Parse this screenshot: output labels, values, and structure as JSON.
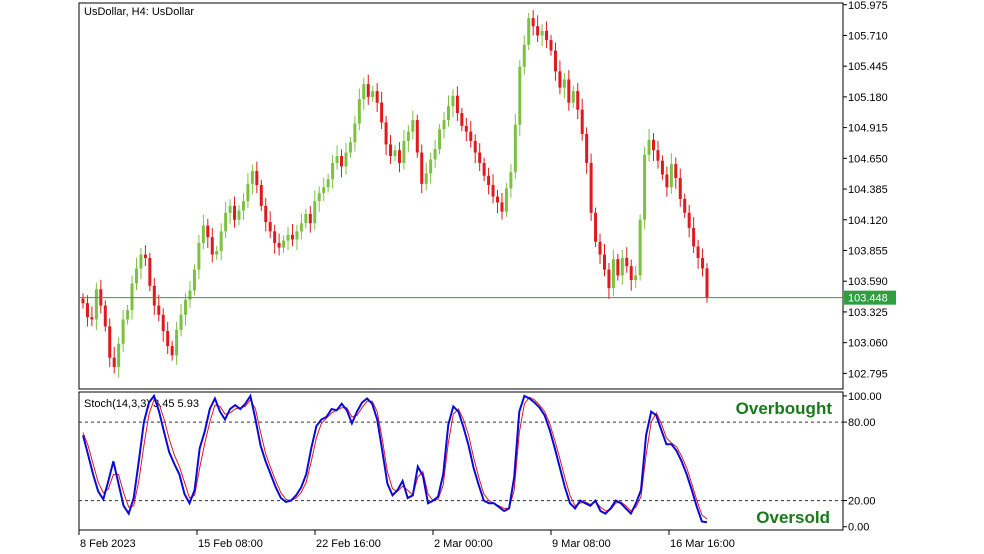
{
  "window": {
    "title": "UsDollar, H4:  UsDollar"
  },
  "colors": {
    "bull": "#7cc242",
    "bear": "#e0191c",
    "grid_border": "#000000",
    "price_line": "#2e9e3e",
    "k_line": "#0a0ad8",
    "d_line": "#e0191c",
    "annotation": "#1a7a1a"
  },
  "chart_data": [
    {
      "type": "candlestick",
      "title": "UsDollar, H4:  UsDollar",
      "y_ticks": [
        "105.975",
        "105.710",
        "105.445",
        "105.180",
        "104.915",
        "104.650",
        "104.385",
        "104.120",
        "103.855",
        "103.590",
        "103.325",
        "103.060",
        "102.795"
      ],
      "ylim": [
        102.66,
        105.99
      ],
      "x_ticks": [
        "8 Feb 2023",
        "15 Feb 08:00",
        "22 Feb 16:00",
        "2 Mar 00:00",
        "9 Mar 08:00",
        "16 Mar 16:00"
      ],
      "current_price": "103.448",
      "close": [
        103.4,
        103.28,
        103.26,
        103.52,
        103.38,
        103.2,
        102.93,
        102.85,
        103.05,
        103.26,
        103.34,
        103.57,
        103.7,
        103.82,
        103.79,
        103.55,
        103.38,
        103.3,
        103.16,
        103.03,
        102.95,
        103.17,
        103.3,
        103.43,
        103.51,
        103.69,
        103.92,
        104.07,
        103.97,
        103.82,
        103.85,
        104.02,
        104.18,
        104.24,
        104.12,
        104.2,
        104.28,
        104.43,
        104.54,
        104.42,
        104.24,
        104.1,
        104.02,
        103.92,
        103.88,
        103.94,
        103.99,
        103.95,
        104.02,
        104.09,
        104.17,
        104.09,
        104.28,
        104.35,
        104.4,
        104.47,
        104.61,
        104.67,
        104.58,
        104.7,
        104.79,
        104.95,
        105.16,
        105.29,
        105.18,
        105.23,
        105.13,
        104.96,
        104.77,
        104.67,
        104.72,
        104.61,
        104.8,
        104.88,
        104.98,
        104.7,
        104.43,
        104.52,
        104.64,
        104.73,
        104.9,
        104.98,
        105.1,
        105.19,
        105.04,
        104.93,
        104.88,
        104.8,
        104.7,
        104.61,
        104.5,
        104.42,
        104.32,
        104.27,
        104.19,
        104.39,
        104.53,
        104.94,
        105.44,
        105.63,
        105.86,
        105.79,
        105.71,
        105.75,
        105.67,
        105.58,
        105.4,
        105.26,
        105.33,
        105.13,
        105.23,
        105.07,
        104.86,
        104.61,
        104.18,
        103.93,
        103.82,
        103.69,
        103.53,
        103.78,
        103.64,
        103.79,
        103.72,
        103.6,
        103.64,
        104.12,
        104.68,
        104.81,
        104.72,
        104.63,
        104.51,
        104.4,
        104.6,
        104.48,
        104.3,
        104.18,
        104.05,
        103.89,
        103.79,
        103.7,
        103.45
      ]
    },
    {
      "type": "line",
      "title": "Stoch(14,3,3) 3.45 5.93",
      "y_ticks": [
        "100.00",
        "80.00",
        "20.00",
        "0.00"
      ],
      "ylim": [
        -2.5,
        103
      ],
      "levels": [
        80,
        20
      ],
      "annotations": [
        "Overbought",
        "Oversold"
      ],
      "series": [
        {
          "values": [
            70,
            55,
            40,
            27,
            21,
            35,
            50,
            33,
            16,
            10,
            22,
            50,
            80,
            95,
            100,
            88,
            72,
            57,
            48,
            40,
            25,
            18,
            28,
            60,
            73,
            90,
            98,
            88,
            82,
            90,
            93,
            90,
            94,
            100,
            82,
            62,
            50,
            40,
            30,
            22,
            19,
            20,
            24,
            30,
            40,
            60,
            77,
            82,
            84,
            90,
            89,
            94,
            89,
            79,
            88,
            95,
            98,
            94,
            82,
            58,
            33,
            24,
            28,
            35,
            22,
            24,
            46,
            39,
            18,
            20,
            23,
            40,
            78,
            92,
            88,
            76,
            62,
            45,
            32,
            20,
            18,
            18,
            15,
            12,
            14,
            38,
            88,
            100,
            98,
            95,
            91,
            85,
            74,
            60,
            45,
            30,
            18,
            14,
            20,
            18,
            16,
            20,
            12,
            10,
            14,
            20,
            18,
            14,
            10,
            18,
            28,
            70,
            88,
            85,
            74,
            63,
            63,
            58,
            50,
            40,
            28,
            15,
            4,
            3.45
          ]
        },
        {
          "values": [
            72,
            62,
            48,
            34,
            26,
            29,
            40,
            40,
            26,
            15,
            16,
            35,
            62,
            86,
            97,
            94,
            82,
            67,
            55,
            46,
            34,
            22,
            24,
            45,
            64,
            80,
            93,
            92,
            86,
            87,
            90,
            91,
            92,
            97,
            90,
            72,
            56,
            45,
            35,
            26,
            21,
            20,
            22,
            26,
            34,
            50,
            68,
            79,
            83,
            87,
            89,
            91,
            91,
            84,
            85,
            91,
            96,
            96,
            88,
            67,
            42,
            29,
            27,
            31,
            28,
            24,
            38,
            42,
            25,
            20,
            21,
            32,
            64,
            86,
            90,
            82,
            70,
            53,
            38,
            25,
            20,
            18,
            16,
            14,
            14,
            28,
            72,
            94,
            99,
            97,
            93,
            88,
            79,
            66,
            52,
            37,
            24,
            16,
            18,
            19,
            17,
            19,
            15,
            12,
            13,
            18,
            19,
            16,
            12,
            15,
            23,
            55,
            80,
            87,
            79,
            68,
            64,
            61,
            54,
            45,
            33,
            20,
            9,
            5.93
          ]
        }
      ]
    }
  ]
}
